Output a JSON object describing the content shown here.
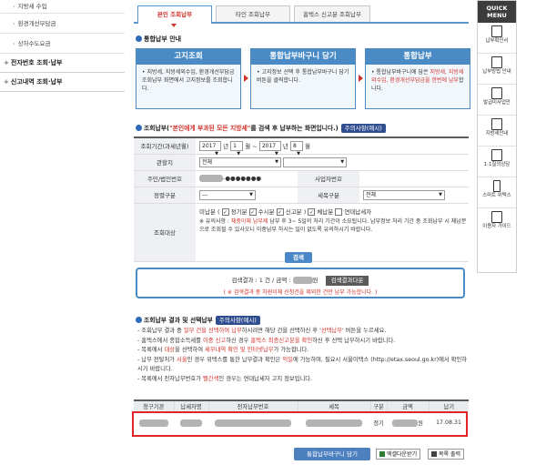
{
  "sidebar": {
    "subitems": [
      "지방세 수입",
      "환경개선부담금",
      "상하수도요금"
    ],
    "menus": [
      "전자번호 조회·납부",
      "신고내역 조회·납부"
    ]
  },
  "tabs": [
    "본인 조회납부",
    "타인 조회납부",
    "홈택스 신고분 조회납부"
  ],
  "guide": {
    "title": "통합납부 안내",
    "cards": [
      {
        "title": "고지조회",
        "body": "지방세, 지방세외수입, 환경개선부담금 조회납부 화면에서 고지정보를 조회합니다."
      },
      {
        "title": "통합납부바구니 담기",
        "body": "고지정보 선택 후 통합납부바구니 담기 버튼을 클릭합니다."
      },
      {
        "title": "통합납부",
        "body_prefix": "통합납부바구니에 담은 ",
        "body_red": "지방세, 지방세외수입, 환경개선부담금을 한번에 납부",
        "body_suffix": "합니다."
      }
    ]
  },
  "search": {
    "title_prefix": "조회납부(",
    "title_red": "\"본인에게 부과된 모든 지방세\"",
    "title_suffix": "를 검색 후 납부하는 화면입니다.)",
    "badge": "주의사항(예시)",
    "period_label": "조회기간(과세년월)",
    "from_year": "2017",
    "from_month": "1",
    "to_year": "2017",
    "to_month": "8",
    "year_unit": "년",
    "month_unit": "월",
    "tilde": "~",
    "office_label": "관할지",
    "office_value": "전체",
    "id_label": "주민/법인번호",
    "id_masked": "-●●●●●●●",
    "bizno_label": "사업자번호",
    "kind_label": "정렬구분",
    "kind_value": "---",
    "tax_label": "세목구분",
    "tax_value": "전체",
    "target_label": "조회대상",
    "target_options": [
      "미납분",
      "정기분",
      "수시분",
      "신고분",
      "체납분",
      "연대납세자"
    ],
    "note_prefix": "※ 유의사항 : ",
    "note_red": "체중이체 납부제",
    "note_body": " 납부 후 3~ 5일의 처리 기간이 소요됩니다. 납부정보 처리 기간 중 조회납부 시 체납분으로 조회될 수 있사오니 이중납부 하시는 일이 없도록 유의하시기 바랍니다.",
    "search_button": "검색"
  },
  "result_summary": {
    "text_prefix": "검색결과 : 1 건 / 금액 : ",
    "text_suffix": "원",
    "download_button": "검색결과다운",
    "notice": "( ※ 검색결과 중 차원이체 신청건을 제외한 건만 납부 가능합니다. )"
  },
  "results": {
    "title": "조회납부 결과 및 선택납부",
    "badge": "주의사항(예시)",
    "bullets": [
      {
        "a": "- 조회납부 결과 중 ",
        "r": "일부 건을 선택하여 납부",
        "b": "하시려면 해당 건을 선택하신 후 '",
        "r2": "선택납부",
        "c": "' 버튼을 누르세요."
      },
      {
        "a": "- 홈택스에서 종합소득세를 ",
        "r": "이중 신고",
        "b": "하신 경우 ",
        "r2": "홈택스 최종신고분을 확인",
        "c": "하신 후 선택 납부하시기 바랍니다."
      },
      {
        "a": "- 목록에서 ",
        "r": "대상",
        "b": "을 선택하여 ",
        "r2": "세부내역 확인 및 인터넷납부",
        "c": "가 가능합니다."
      },
      {
        "a": "- 납부 전탈처가 ",
        "r": "서울",
        "b": "인 경우 위택스를 통한 납부결과 확인은 ",
        "r2": "익일",
        "c": "에 가능하며, 필요시 서울이택스 (http://etax.seoul.go.kr)에서 확인하시기 바랍니다."
      },
      {
        "a": "- 목록에서 전자납부번호가 ",
        "r": "빨간색",
        "b": "인 경우는 연대납세자 고지 정보입니다.",
        "r2": "",
        "c": ""
      }
    ],
    "columns": [
      "청구기관",
      "납세자명",
      "전자납부번호",
      "세목",
      "구분",
      "금액",
      "납기"
    ],
    "row": {
      "type": "정기",
      "amount_unit": "원",
      "due": "17.08.31"
    }
  },
  "actions": {
    "cart_button": "통합납부바구니 담기",
    "excel_button": "엑셀다운받기",
    "print_button": "목록 출력"
  },
  "quick_menu": {
    "title": "QUICK MENU",
    "items": [
      "납부확인서",
      "납부방법 안내",
      "발급미사업만",
      "지방세안내",
      "1:1질의상담",
      "스마트 위택스",
      "이용자 가이드"
    ]
  }
}
